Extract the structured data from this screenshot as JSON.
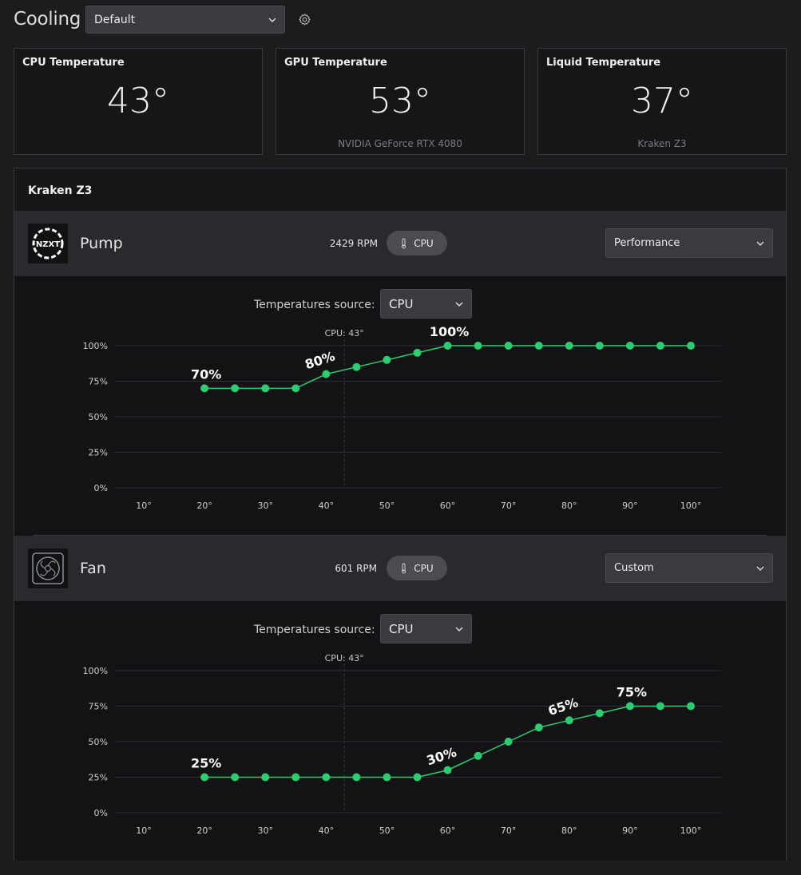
{
  "header": {
    "title": "Cooling",
    "profile": "Default",
    "settings_icon": "gear-icon"
  },
  "temps": [
    {
      "label": "CPU Temperature",
      "value": "43°",
      "sub": ""
    },
    {
      "label": "GPU Temperature",
      "value": "53°",
      "sub": "NVIDIA GeForce RTX 4080"
    },
    {
      "label": "Liquid Temperature",
      "value": "37°",
      "sub": "Kraken Z3"
    }
  ],
  "kraken": {
    "title": "Kraken Z3",
    "pump": {
      "name": "Pump",
      "rpm": "2429 RPM",
      "source": "CPU",
      "mode": "Performance",
      "temp_source_label": "Temperatures source:",
      "temp_source": "CPU",
      "marker_label": "CPU: 43°"
    },
    "fan": {
      "name": "Fan",
      "rpm": "601 RPM",
      "source": "CPU",
      "mode": "Custom",
      "temp_source_label": "Temperatures source:",
      "temp_source": "CPU",
      "marker_label": "CPU: 43°"
    }
  },
  "chart_data": [
    {
      "type": "line",
      "name": "pump-curve",
      "x": [
        20,
        25,
        30,
        35,
        40,
        45,
        50,
        55,
        60,
        65,
        70,
        75,
        80,
        85,
        90,
        95,
        100
      ],
      "y": [
        70,
        70,
        70,
        70,
        80,
        85,
        90,
        95,
        100,
        100,
        100,
        100,
        100,
        100,
        100,
        100,
        100
      ],
      "xticks": [
        "10°",
        "20°",
        "30°",
        "40°",
        "50°",
        "60°",
        "70°",
        "80°",
        "90°",
        "100°"
      ],
      "yticks": [
        "0%",
        "25%",
        "50%",
        "75%",
        "100%"
      ],
      "xlim": [
        10,
        100
      ],
      "ylim": [
        0,
        100
      ],
      "marker_x": 43,
      "marker_label": "CPU: 43°",
      "annotations": [
        {
          "x": 20,
          "y": 70,
          "text": "70%"
        },
        {
          "x": 40,
          "y": 80,
          "text": "80%"
        },
        {
          "x": 60,
          "y": 100,
          "text": "100%"
        }
      ],
      "color": "#2ecc71"
    },
    {
      "type": "line",
      "name": "fan-curve",
      "x": [
        20,
        25,
        30,
        35,
        40,
        45,
        50,
        55,
        60,
        65,
        70,
        75,
        80,
        85,
        90,
        95,
        100
      ],
      "y": [
        25,
        25,
        25,
        25,
        25,
        25,
        25,
        25,
        30,
        40,
        50,
        60,
        65,
        70,
        75,
        75,
        75
      ],
      "xticks": [
        "10°",
        "20°",
        "30°",
        "40°",
        "50°",
        "60°",
        "70°",
        "80°",
        "90°",
        "100°"
      ],
      "yticks": [
        "0%",
        "25%",
        "50%",
        "75%",
        "100%"
      ],
      "xlim": [
        10,
        100
      ],
      "ylim": [
        0,
        100
      ],
      "marker_x": 43,
      "marker_label": "CPU: 43°",
      "annotations": [
        {
          "x": 20,
          "y": 25,
          "text": "25%"
        },
        {
          "x": 60,
          "y": 30,
          "text": "30%"
        },
        {
          "x": 80,
          "y": 65,
          "text": "65%"
        },
        {
          "x": 90,
          "y": 75,
          "text": "75%"
        }
      ],
      "color": "#2ecc71"
    }
  ]
}
